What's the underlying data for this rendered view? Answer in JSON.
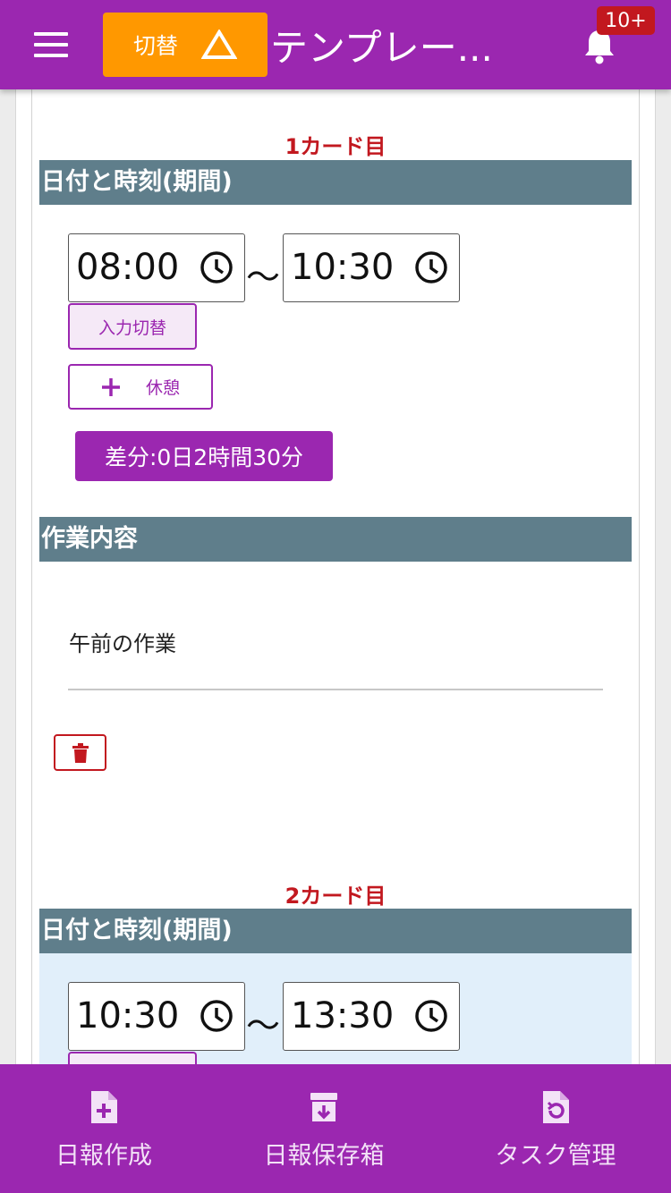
{
  "header": {
    "switch_label": "切替",
    "title": "テンプレー...",
    "notification_badge": "10+"
  },
  "cards": [
    {
      "title": "1カード目",
      "datetime_heading": "日付と時刻(期間)",
      "start_time": "08:00",
      "separator": "〜",
      "end_time": "10:30",
      "input_toggle_label": "入力切替",
      "break_label": "休憩",
      "diff_label": "差分:0日2時間30分",
      "work_heading": "作業内容",
      "work_content": "午前の作業"
    },
    {
      "title": "2カード目",
      "datetime_heading": "日付と時刻(期間)",
      "start_time": "10:30",
      "separator": "〜",
      "end_time": "13:30"
    }
  ],
  "bottom_nav": {
    "items": [
      {
        "label": "日報作成",
        "icon": "file-plus-icon"
      },
      {
        "label": "日報保存箱",
        "icon": "archive-icon"
      },
      {
        "label": "タスク管理",
        "icon": "file-restore-icon"
      }
    ]
  },
  "colors": {
    "primary": "#9b27b0",
    "accent_orange": "#ff9800",
    "danger": "#c2181f",
    "section_header": "#5f7e8b"
  }
}
